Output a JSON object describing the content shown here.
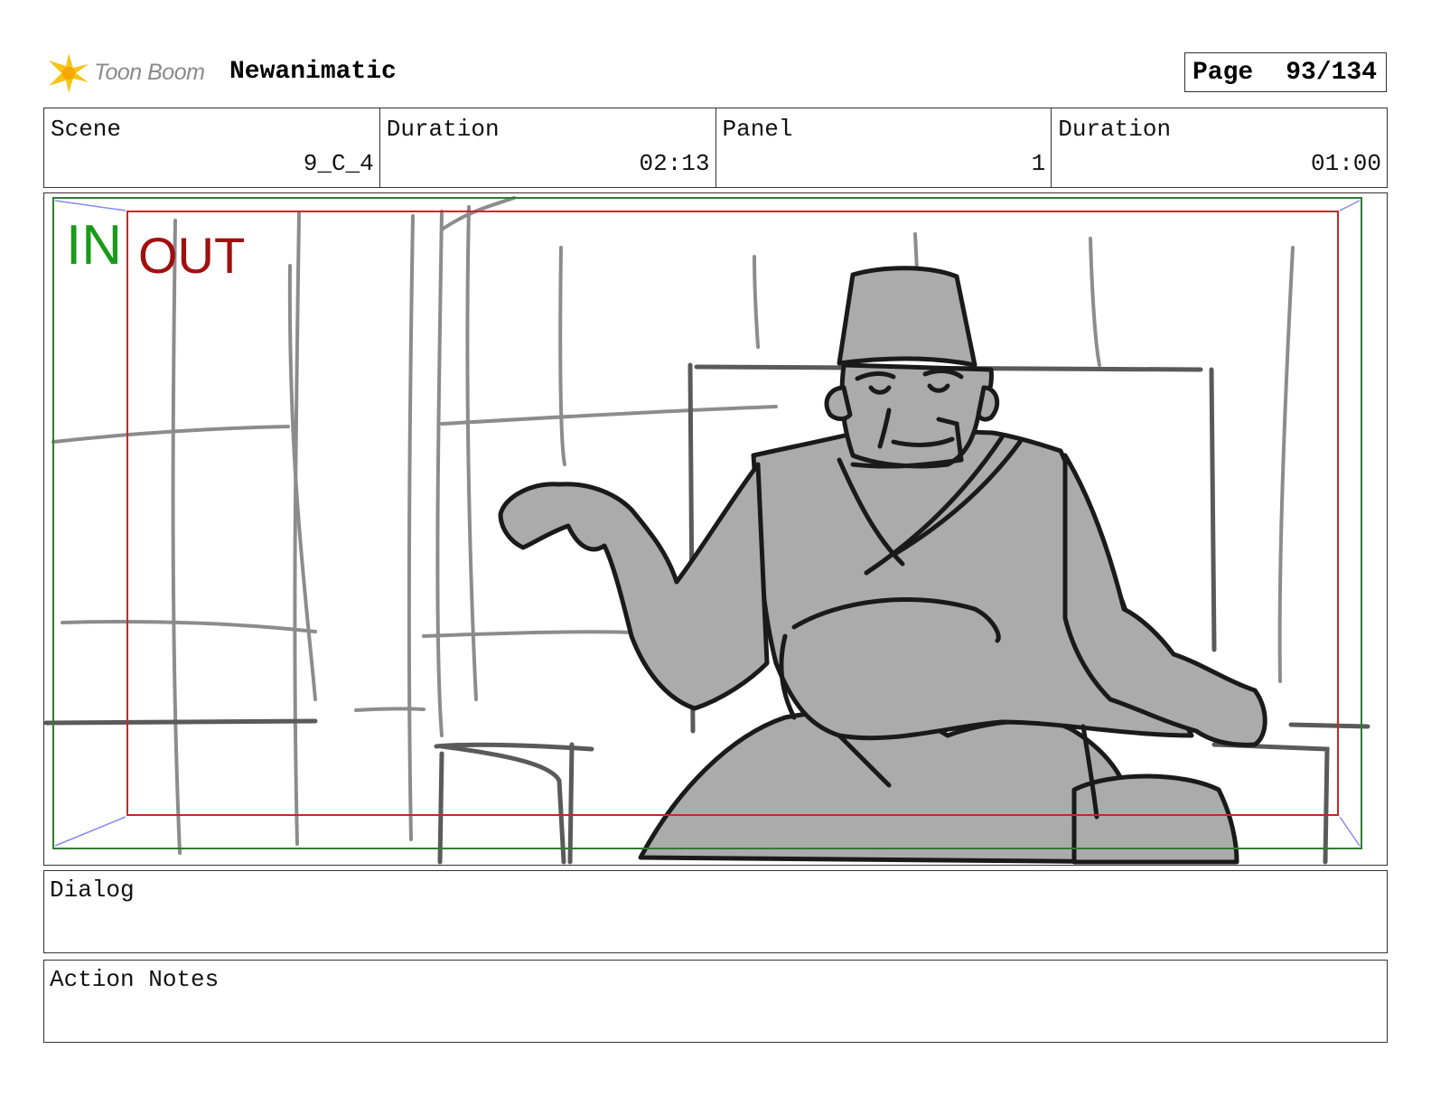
{
  "header": {
    "logo_text": "Toon Boom",
    "project_title": "Newanimatic",
    "page_label": "Page",
    "page_number": "93/134"
  },
  "info": {
    "scene_label": "Scene",
    "scene_value": "9_C_4",
    "scene_duration_label": "Duration",
    "scene_duration_value": "02:13",
    "panel_label": "Panel",
    "panel_value": "1",
    "panel_duration_label": "Duration",
    "panel_duration_value": "01:00"
  },
  "panel": {
    "in_marker": "IN",
    "out_marker": "OUT",
    "in_color": "#1a9a1a",
    "out_color": "#a01010",
    "safe_in_frame_color": "#2e7d32",
    "safe_out_frame_color": "#c62828"
  },
  "dialog": {
    "label": "Dialog",
    "text": ""
  },
  "action_notes": {
    "label": "Action Notes",
    "text": ""
  }
}
